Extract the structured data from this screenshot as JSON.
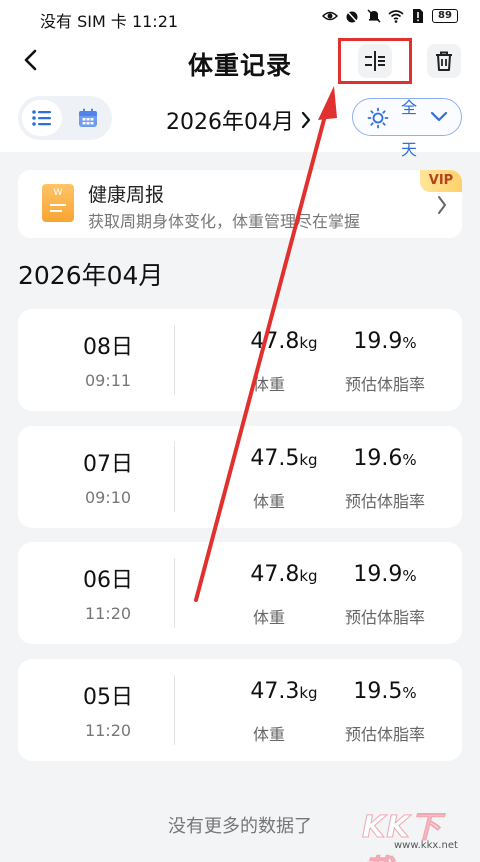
{
  "status_bar": {
    "carrier_time": "没有 SIM 卡 11:21",
    "battery": "89"
  },
  "header": {
    "title": "体重记录"
  },
  "toolbar": {
    "month_label": "2026年04月",
    "day_filter_label": "全天"
  },
  "banner": {
    "title": "健康周报",
    "subtitle": "获取周期身体变化，体重管理尽在掌握",
    "badge": "VIP",
    "icon_letter": "W"
  },
  "section": {
    "title": "2026年04月"
  },
  "records": [
    {
      "day": "08日",
      "time": "09:11",
      "weight": "47.8",
      "weight_unit": "kg",
      "weight_label": "体重",
      "fat": "19.9",
      "fat_unit": "%",
      "fat_label": "预估体脂率"
    },
    {
      "day": "07日",
      "time": "09:10",
      "weight": "47.5",
      "weight_unit": "kg",
      "weight_label": "体重",
      "fat": "19.6",
      "fat_unit": "%",
      "fat_label": "预估体脂率"
    },
    {
      "day": "06日",
      "time": "11:20",
      "weight": "47.8",
      "weight_unit": "kg",
      "weight_label": "体重",
      "fat": "19.9",
      "fat_unit": "%",
      "fat_label": "预估体脂率"
    },
    {
      "day": "05日",
      "time": "11:20",
      "weight": "47.3",
      "weight_unit": "kg",
      "weight_label": "体重",
      "fat": "19.5",
      "fat_unit": "%",
      "fat_label": "预估体脂率"
    }
  ],
  "footer": {
    "no_more": "没有更多的数据了"
  },
  "watermark": {
    "text": "KK下载",
    "url": "www.kkx.net"
  },
  "colors": {
    "accent": "#2f6fe0",
    "annotation_red": "#e0312f",
    "vip_gold": "#f7a531"
  },
  "icons": [
    "back-arrow-icon",
    "filter-icon",
    "trash-icon",
    "list-icon",
    "calendar-icon",
    "sun-icon",
    "chevron-down-icon",
    "chevron-right-icon",
    "report-icon"
  ]
}
